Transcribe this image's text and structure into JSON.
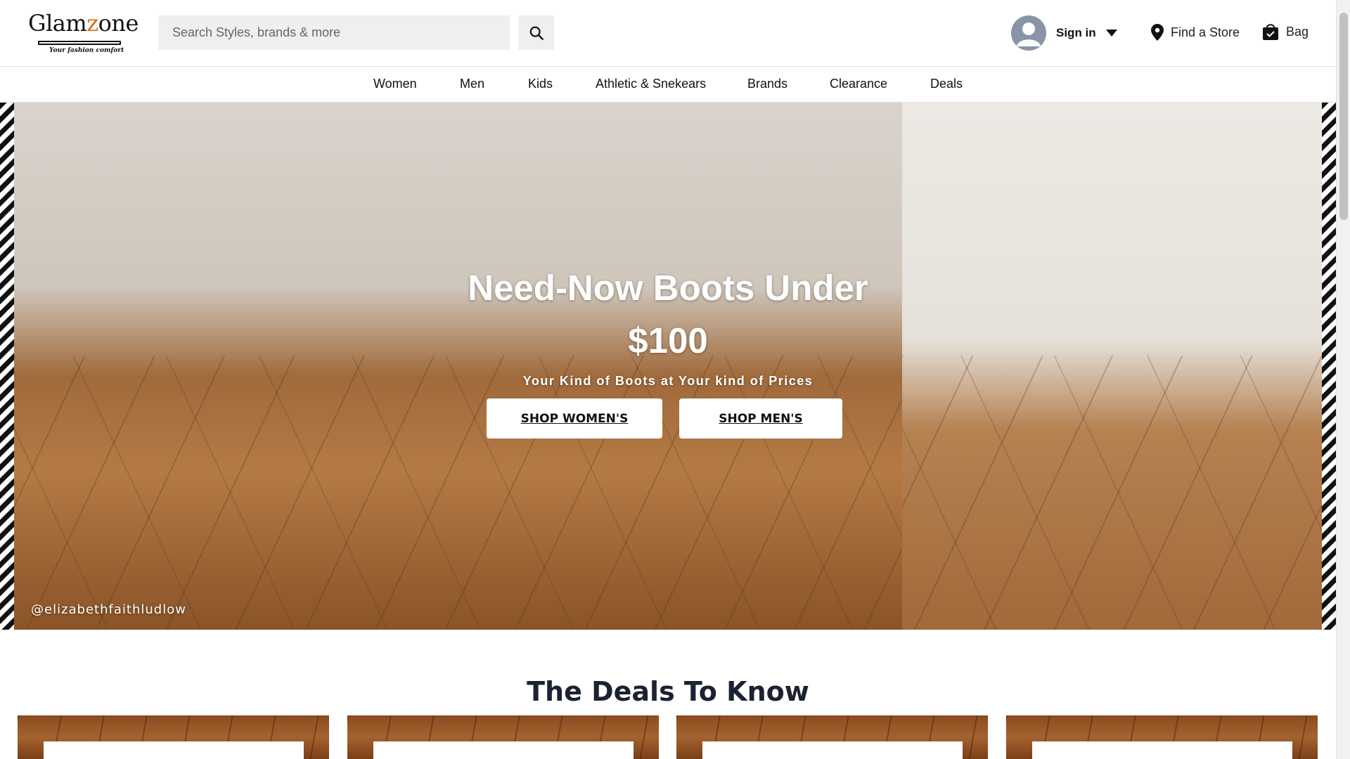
{
  "brand": {
    "name_part1": "Glam",
    "name_part2": "z",
    "name_part3": "one",
    "tagline": "Your fashion comfort"
  },
  "search": {
    "placeholder": "Search Styles, brands & more"
  },
  "account": {
    "signin_label": "Sign in"
  },
  "utility": {
    "find_store_label": "Find a Store",
    "bag_label": "Bag"
  },
  "nav": {
    "items": [
      {
        "label": "Women"
      },
      {
        "label": "Men"
      },
      {
        "label": "Kids"
      },
      {
        "label": "Athletic & Snekears"
      },
      {
        "label": "Brands"
      },
      {
        "label": "Clearance"
      },
      {
        "label": "Deals"
      }
    ]
  },
  "hero": {
    "title": "Need-Now Boots Under $100",
    "subtitle": "Your Kind of Boots at Your kind of Prices",
    "shop_womens_label": "SHOP WOMEN'S",
    "shop_mens_label": "SHOP MEN'S",
    "credit": "@elizabethfaithludlow"
  },
  "deals": {
    "title": "The Deals To Know"
  },
  "colors": {
    "logo_accent": "#e06a1a",
    "heading_text": "#1a2233",
    "search_bg": "#efefef"
  },
  "icons": {
    "search": "search-icon",
    "avatar": "user-avatar-icon",
    "caret": "caret-down-icon",
    "store": "map-pin-icon",
    "bag": "shopping-bag-icon"
  }
}
